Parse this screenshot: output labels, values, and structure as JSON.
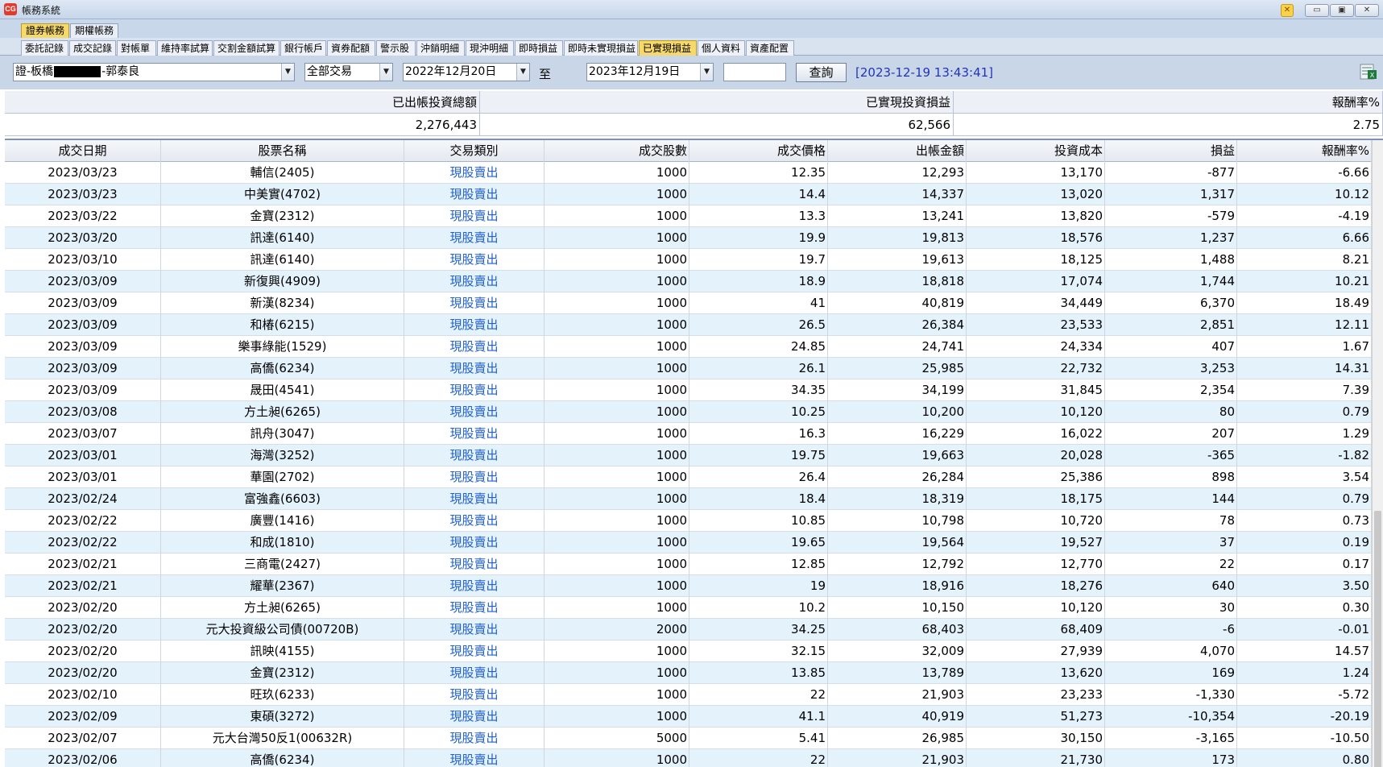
{
  "window": {
    "title": "帳務系統",
    "app_icon_text": "CG"
  },
  "top_tabs": [
    {
      "label": "證券帳務",
      "active": true
    },
    {
      "label": "期權帳務",
      "active": false
    }
  ],
  "sub_tabs": [
    {
      "label": "委託記錄",
      "active": false
    },
    {
      "label": "成交記錄",
      "active": false
    },
    {
      "label": "對帳單",
      "active": false
    },
    {
      "label": "維持率試算",
      "active": false
    },
    {
      "label": "交割金額試算",
      "active": false
    },
    {
      "label": "銀行帳戶",
      "active": false
    },
    {
      "label": "資券配額",
      "active": false
    },
    {
      "label": "警示股",
      "active": false
    },
    {
      "label": "沖銷明細",
      "active": false
    },
    {
      "label": "現沖明細",
      "active": false
    },
    {
      "label": "即時損益",
      "active": false
    },
    {
      "label": "即時未實現損益",
      "active": false
    },
    {
      "label": "已實現損益",
      "active": true
    },
    {
      "label": "個人資料",
      "active": false
    },
    {
      "label": "資產配置",
      "active": false
    }
  ],
  "toolbar": {
    "account_prefix": "證-板橋",
    "account_suffix": "-郭泰良",
    "trade_type": "全部交易",
    "date_from": "2022年12月20日",
    "to_label": "至",
    "date_to": "2023年12月19日",
    "extra_input": "",
    "query_label": "查詢",
    "timestamp": "[2023-12-19 13:43:41]"
  },
  "summary": {
    "headers": [
      "已出帳投資總額",
      "已實現投資損益",
      "報酬率%"
    ],
    "values": [
      "2,276,443",
      "62,566",
      "2.75"
    ]
  },
  "table": {
    "columns": [
      "成交日期",
      "股票名稱",
      "交易類別",
      "成交股數",
      "成交價格",
      "出帳金額",
      "投資成本",
      "損益",
      "報酬率%"
    ],
    "rows": [
      [
        "2023/03/23",
        "輔信(2405)",
        "現股賣出",
        "1000",
        "12.35",
        "12,293",
        "13,170",
        "-877",
        "-6.66"
      ],
      [
        "2023/03/23",
        "中美實(4702)",
        "現股賣出",
        "1000",
        "14.4",
        "14,337",
        "13,020",
        "1,317",
        "10.12"
      ],
      [
        "2023/03/22",
        "金寶(2312)",
        "現股賣出",
        "1000",
        "13.3",
        "13,241",
        "13,820",
        "-579",
        "-4.19"
      ],
      [
        "2023/03/20",
        "訊達(6140)",
        "現股賣出",
        "1000",
        "19.9",
        "19,813",
        "18,576",
        "1,237",
        "6.66"
      ],
      [
        "2023/03/10",
        "訊達(6140)",
        "現股賣出",
        "1000",
        "19.7",
        "19,613",
        "18,125",
        "1,488",
        "8.21"
      ],
      [
        "2023/03/09",
        "新復興(4909)",
        "現股賣出",
        "1000",
        "18.9",
        "18,818",
        "17,074",
        "1,744",
        "10.21"
      ],
      [
        "2023/03/09",
        "新漢(8234)",
        "現股賣出",
        "1000",
        "41",
        "40,819",
        "34,449",
        "6,370",
        "18.49"
      ],
      [
        "2023/03/09",
        "和椿(6215)",
        "現股賣出",
        "1000",
        "26.5",
        "26,384",
        "23,533",
        "2,851",
        "12.11"
      ],
      [
        "2023/03/09",
        "樂事綠能(1529)",
        "現股賣出",
        "1000",
        "24.85",
        "24,741",
        "24,334",
        "407",
        "1.67"
      ],
      [
        "2023/03/09",
        "高僑(6234)",
        "現股賣出",
        "1000",
        "26.1",
        "25,985",
        "22,732",
        "3,253",
        "14.31"
      ],
      [
        "2023/03/09",
        "晟田(4541)",
        "現股賣出",
        "1000",
        "34.35",
        "34,199",
        "31,845",
        "2,354",
        "7.39"
      ],
      [
        "2023/03/08",
        "方土昶(6265)",
        "現股賣出",
        "1000",
        "10.25",
        "10,200",
        "10,120",
        "80",
        "0.79"
      ],
      [
        "2023/03/07",
        "訊舟(3047)",
        "現股賣出",
        "1000",
        "16.3",
        "16,229",
        "16,022",
        "207",
        "1.29"
      ],
      [
        "2023/03/01",
        "海灣(3252)",
        "現股賣出",
        "1000",
        "19.75",
        "19,663",
        "20,028",
        "-365",
        "-1.82"
      ],
      [
        "2023/03/01",
        "華園(2702)",
        "現股賣出",
        "1000",
        "26.4",
        "26,284",
        "25,386",
        "898",
        "3.54"
      ],
      [
        "2023/02/24",
        "富強鑫(6603)",
        "現股賣出",
        "1000",
        "18.4",
        "18,319",
        "18,175",
        "144",
        "0.79"
      ],
      [
        "2023/02/22",
        "廣豐(1416)",
        "現股賣出",
        "1000",
        "10.85",
        "10,798",
        "10,720",
        "78",
        "0.73"
      ],
      [
        "2023/02/22",
        "和成(1810)",
        "現股賣出",
        "1000",
        "19.65",
        "19,564",
        "19,527",
        "37",
        "0.19"
      ],
      [
        "2023/02/21",
        "三商電(2427)",
        "現股賣出",
        "1000",
        "12.85",
        "12,792",
        "12,770",
        "22",
        "0.17"
      ],
      [
        "2023/02/21",
        "耀華(2367)",
        "現股賣出",
        "1000",
        "19",
        "18,916",
        "18,276",
        "640",
        "3.50"
      ],
      [
        "2023/02/20",
        "方土昶(6265)",
        "現股賣出",
        "1000",
        "10.2",
        "10,150",
        "10,120",
        "30",
        "0.30"
      ],
      [
        "2023/02/20",
        "元大投資級公司債(00720B)",
        "現股賣出",
        "2000",
        "34.25",
        "68,403",
        "68,409",
        "-6",
        "-0.01"
      ],
      [
        "2023/02/20",
        "訊映(4155)",
        "現股賣出",
        "1000",
        "32.15",
        "32,009",
        "27,939",
        "4,070",
        "14.57"
      ],
      [
        "2023/02/20",
        "金寶(2312)",
        "現股賣出",
        "1000",
        "13.85",
        "13,789",
        "13,620",
        "169",
        "1.24"
      ],
      [
        "2023/02/10",
        "旺玖(6233)",
        "現股賣出",
        "1000",
        "22",
        "21,903",
        "23,233",
        "-1,330",
        "-5.72"
      ],
      [
        "2023/02/09",
        "東碩(3272)",
        "現股賣出",
        "1000",
        "41.1",
        "40,919",
        "51,273",
        "-10,354",
        "-20.19"
      ],
      [
        "2023/02/07",
        "元大台灣50反1(00632R)",
        "現股賣出",
        "5000",
        "5.41",
        "26,985",
        "30,150",
        "-3,165",
        "-10.50"
      ],
      [
        "2023/02/06",
        "高僑(6234)",
        "現股賣出",
        "1000",
        "22",
        "21,903",
        "21,730",
        "173",
        "0.80"
      ]
    ]
  },
  "icons": {
    "export": "excel-export-icon",
    "dropdown": "chevron-down-icon"
  },
  "colors": {
    "link": "#1f5fcf",
    "timestamp": "#2233bb",
    "row_alt": "#e4f2fc",
    "active_tab": "#f6d96a"
  }
}
